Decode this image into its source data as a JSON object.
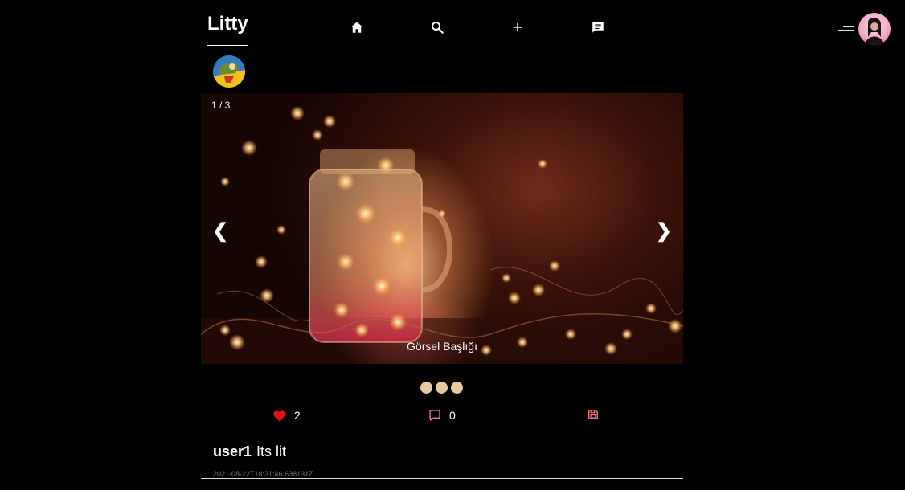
{
  "app": {
    "logo": "Litty"
  },
  "nav": {
    "items": [
      {
        "icon": "home-icon"
      },
      {
        "icon": "search-icon"
      },
      {
        "icon": "plus-icon"
      },
      {
        "icon": "chat-icon"
      }
    ]
  },
  "post": {
    "slideshow": {
      "counter": "1 / 3",
      "prev_label": "❮",
      "next_label": "❯",
      "caption": "Görsel Başlığı",
      "dot_count": 3
    },
    "likes": {
      "count": "2",
      "icon": "heart-icon",
      "color": "#e0101a"
    },
    "comments": {
      "count": "0",
      "icon": "comment-icon",
      "color": "#f08080"
    },
    "save": {
      "icon": "save-icon",
      "color": "#f08080"
    },
    "username": "user1",
    "text": "Its lit",
    "timestamp": "2021-08-22T18:31:46.638131Z"
  }
}
